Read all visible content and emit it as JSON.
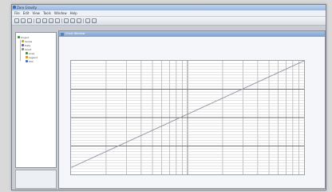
{
  "window": {
    "title": "Zero Gravity"
  },
  "menu": {
    "items": [
      "File",
      "Edit",
      "View",
      "Tools",
      "Window",
      "Help"
    ]
  },
  "toolbar": {
    "buttons": [
      "new-icon",
      "open-icon",
      "save-icon",
      "print-icon",
      "cut-icon",
      "copy-icon",
      "paste-icon",
      "undo-icon",
      "redo-icon",
      "zoom-icon",
      "chart-icon",
      "help-icon"
    ]
  },
  "tree": {
    "nodes": [
      "Project",
      "Series",
      "Data",
      "Chart",
      "Axes",
      "Legend",
      "Plot"
    ],
    "icon_colors": [
      "#3a8f3a",
      "#d19a2a",
      "#3f6fb3",
      "#8a8a8a",
      "#3a8f3a",
      "#d19a2a",
      "#3f6fb3"
    ]
  },
  "chart_window": {
    "title": "Chart Window"
  },
  "chart_data": {
    "type": "line",
    "title": "",
    "xlabel": "",
    "ylabel": "",
    "x_scale": "log",
    "grid": true,
    "xlim": [
      1,
      100
    ],
    "ylim": [
      0,
      1
    ],
    "x_tick_labels": [],
    "y_tick_labels": [],
    "series": [
      {
        "x": [
          1,
          100
        ],
        "y": [
          0.06,
          1.0
        ],
        "color": "#8a95a3"
      }
    ]
  }
}
